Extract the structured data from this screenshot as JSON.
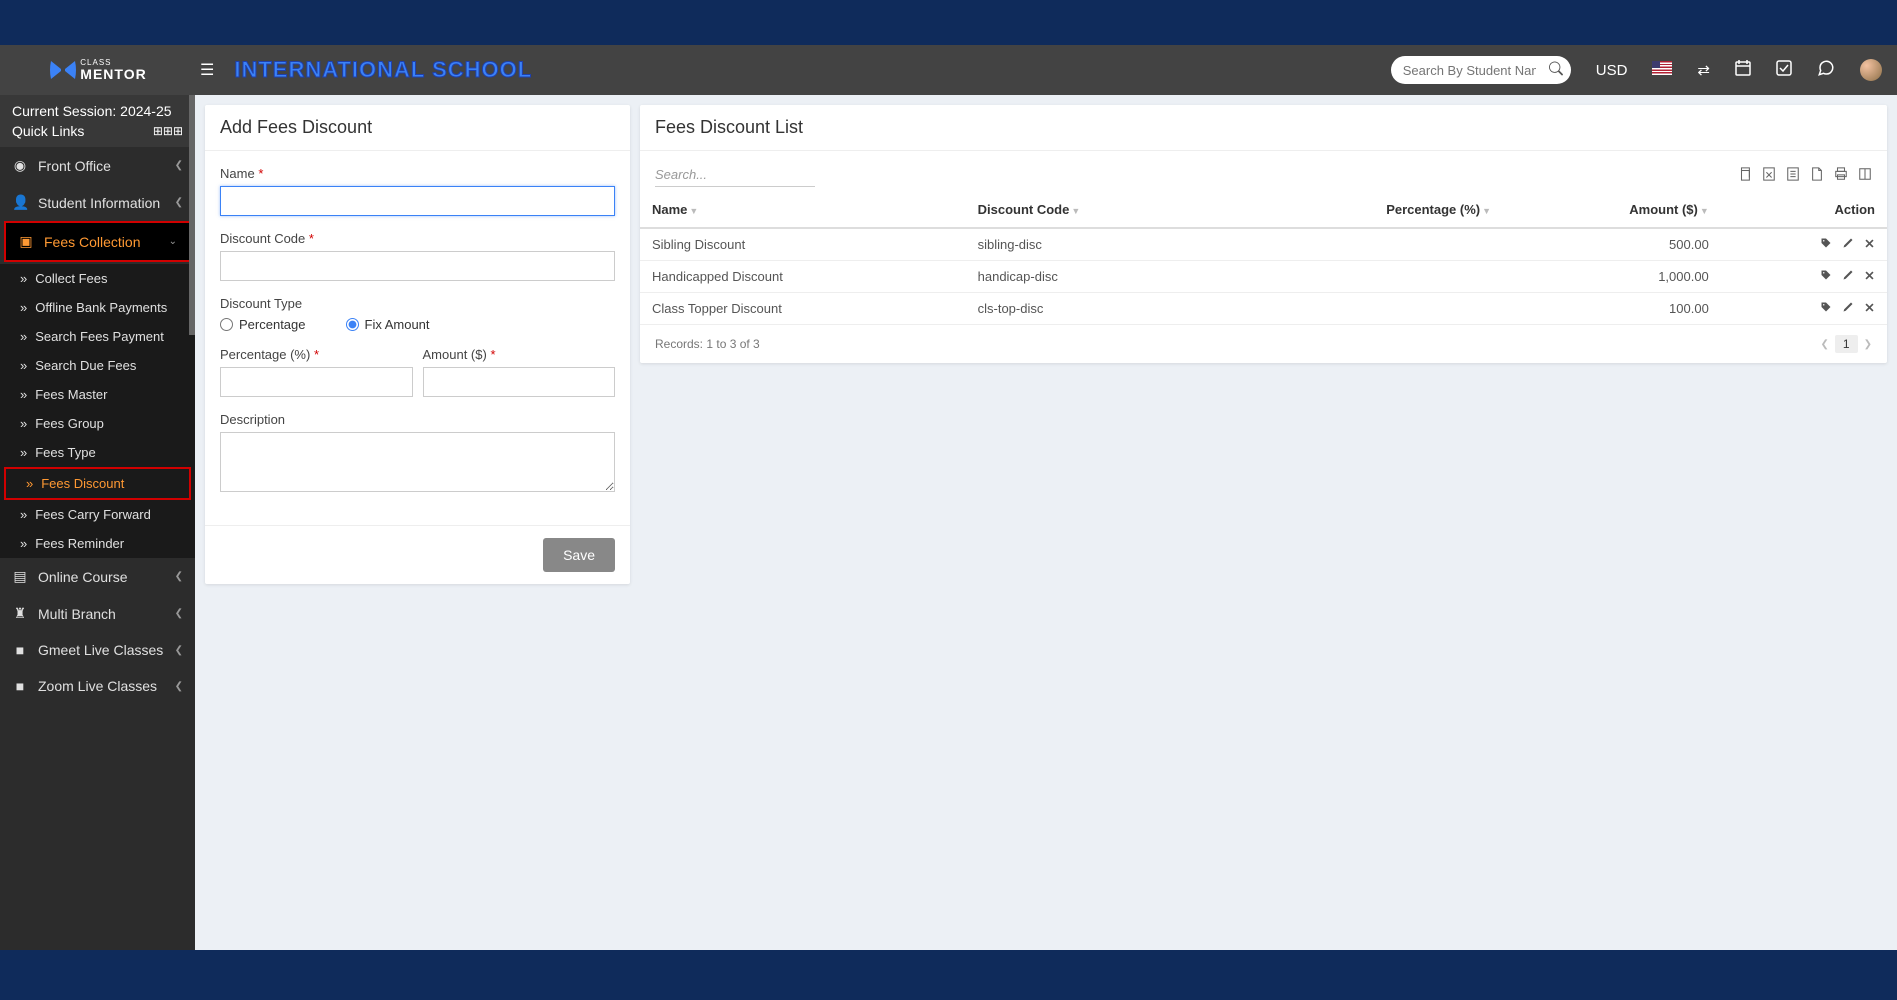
{
  "header": {
    "school_title": "INTERNATIONAL SCHOOL",
    "search_placeholder": "Search By Student Name",
    "currency": "USD"
  },
  "sidebar": {
    "session_label": "Current Session: 2024-25",
    "quick_links": "Quick Links",
    "front_office": "Front Office",
    "student_info": "Student Information",
    "fees_collection": "Fees Collection",
    "sub": {
      "collect_fees": "Collect Fees",
      "offline_bank": "Offline Bank Payments",
      "search_fees": "Search Fees Payment",
      "search_due": "Search Due Fees",
      "fees_master": "Fees Master",
      "fees_group": "Fees Group",
      "fees_type": "Fees Type",
      "fees_discount": "Fees Discount",
      "fees_carry": "Fees Carry Forward",
      "fees_reminder": "Fees Reminder"
    },
    "online_course": "Online Course",
    "multi_branch": "Multi Branch",
    "gmeet": "Gmeet Live Classes",
    "zoom": "Zoom Live Classes"
  },
  "form": {
    "title": "Add Fees Discount",
    "name_label": "Name",
    "code_label": "Discount Code",
    "type_label": "Discount Type",
    "type_percentage": "Percentage",
    "type_fix": "Fix Amount",
    "percentage_label": "Percentage (%)",
    "amount_label": "Amount ($)",
    "desc_label": "Description",
    "save": "Save"
  },
  "list": {
    "title": "Fees Discount List",
    "search_placeholder": "Search...",
    "col_name": "Name",
    "col_code": "Discount Code",
    "col_percent": "Percentage (%)",
    "col_amount": "Amount ($)",
    "col_action": "Action",
    "rows": [
      {
        "name": "Sibling Discount",
        "code": "sibling-disc",
        "percent": "",
        "amount": "500.00"
      },
      {
        "name": "Handicapped Discount",
        "code": "handicap-disc",
        "percent": "",
        "amount": "1,000.00"
      },
      {
        "name": "Class Topper Discount",
        "code": "cls-top-disc",
        "percent": "",
        "amount": "100.00"
      }
    ],
    "records_text": "Records: 1 to 3 of 3",
    "page": "1"
  }
}
